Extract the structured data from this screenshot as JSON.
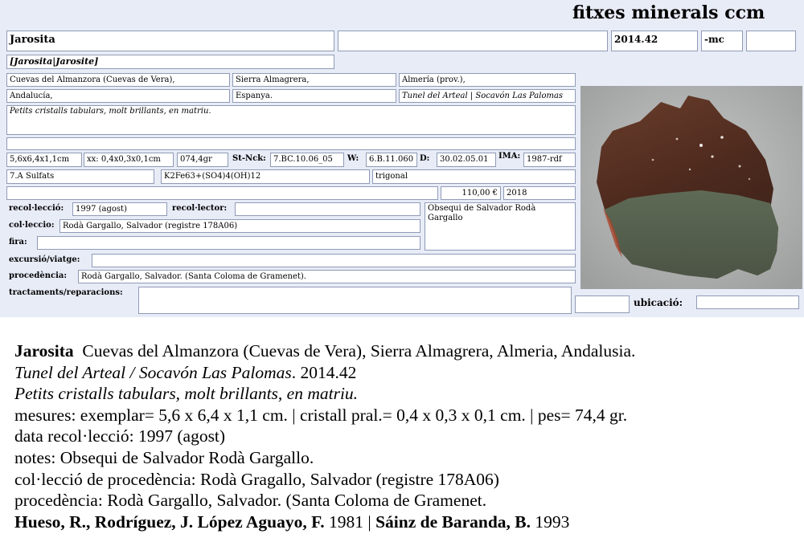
{
  "header": {
    "title": "fitxes minerals ccm"
  },
  "card": {
    "name": "Jarosita",
    "blank_top": "",
    "catalog_number": "2014.42",
    "suffix": "-mc",
    "blank_top_right": "",
    "synonyms": "[Jarosita|Jarosite]",
    "locality": {
      "site": "Cuevas del Almanzora (Cuevas de Vera),",
      "range": "Sierra Almagrera,",
      "province": "Almería (prov.),",
      "region": "Andalucía,",
      "country": "Espanya.",
      "mine": "Tunel del Arteal | Socavón Las Palomas"
    },
    "description": "Petits cristalls tabulars, molt brillants, en matriu.",
    "blank_line": "",
    "measurements": {
      "specimen": "5,6x6,4x1,1cm",
      "crystal": "xx: 0,4x0,3x0,1cm",
      "weight": "074,4gr",
      "strunz_label": "St-Nck:",
      "strunz": "7.BC.10.06_05",
      "w_label": "W:",
      "w_value": "6.B.11.060",
      "d_label": "D:",
      "d_value": "30.02.05.01",
      "ima_label": "IMA:",
      "ima_value": "1987-rdf"
    },
    "class": "7.A Sulfats",
    "formula": "K2Fe63+(SO4)4(OH)12",
    "crystal_system": "trigonal",
    "blank_price_row": "",
    "price": "110,00 €",
    "year": "2018",
    "collection_date_label": "recol·lecció:",
    "collection_date": "1997 (agost)",
    "collector_label": "recol·lector:",
    "collector": "",
    "notes": "Obsequi de Salvador Rodà Gargallo",
    "collection_label": "col·leccio:",
    "collection": "Rodà Gargallo, Salvador (registre 178A06)",
    "fair_label": "fira:",
    "fair": "",
    "excursion_label": "excursió/viatge:",
    "excursion": "",
    "provenance_label": "procedència:",
    "provenance": "Rodà Gargallo, Salvador. (Santa Coloma de Gramenet).",
    "treatments_label": "tractaments/reparacions:",
    "treatments": "",
    "blank_bottom": "",
    "location_label": "ubicació:",
    "location": ""
  },
  "summary": {
    "name": "Jarosita",
    "locality": "Cuevas del Almanzora (Cuevas de Vera), Sierra Almagrera, Almeria, Andalusia.",
    "mine": "Tunel del Arteal / Socavón Las Palomas",
    "catalog": ". 2014.42",
    "description": "Petits cristalls tabulars, molt brillants, en matriu.",
    "measures": "mesures: exemplar= 5,6 x 6,4 x 1,1 cm. | cristall pral.=  0,4 x 0,3 x 0,1 cm. | pes= 74,4 gr.",
    "collection_date": "data recol·lecció: 1997 (agost)",
    "notes": "notes:  Obsequi de Salvador Rodà Gargallo.",
    "collection": "col·lecció de procedència: Rodà Gragallo, Salvador (registre 178A06)",
    "provenance": "procedència: Rodà Gargallo, Salvador. (Santa Coloma de Gramenet.",
    "ref1_authors": "Hueso, R., Rodríguez, J. López Aguayo, F.",
    "ref1_year": " 1981 | ",
    "ref2_authors": "Sáinz de Baranda, B.",
    "ref2_year": " 1993"
  },
  "colors": {
    "card_bg": "#e8ecf7",
    "field_border": "#8f9bb5",
    "photo_bg": "#b3b5b4"
  }
}
